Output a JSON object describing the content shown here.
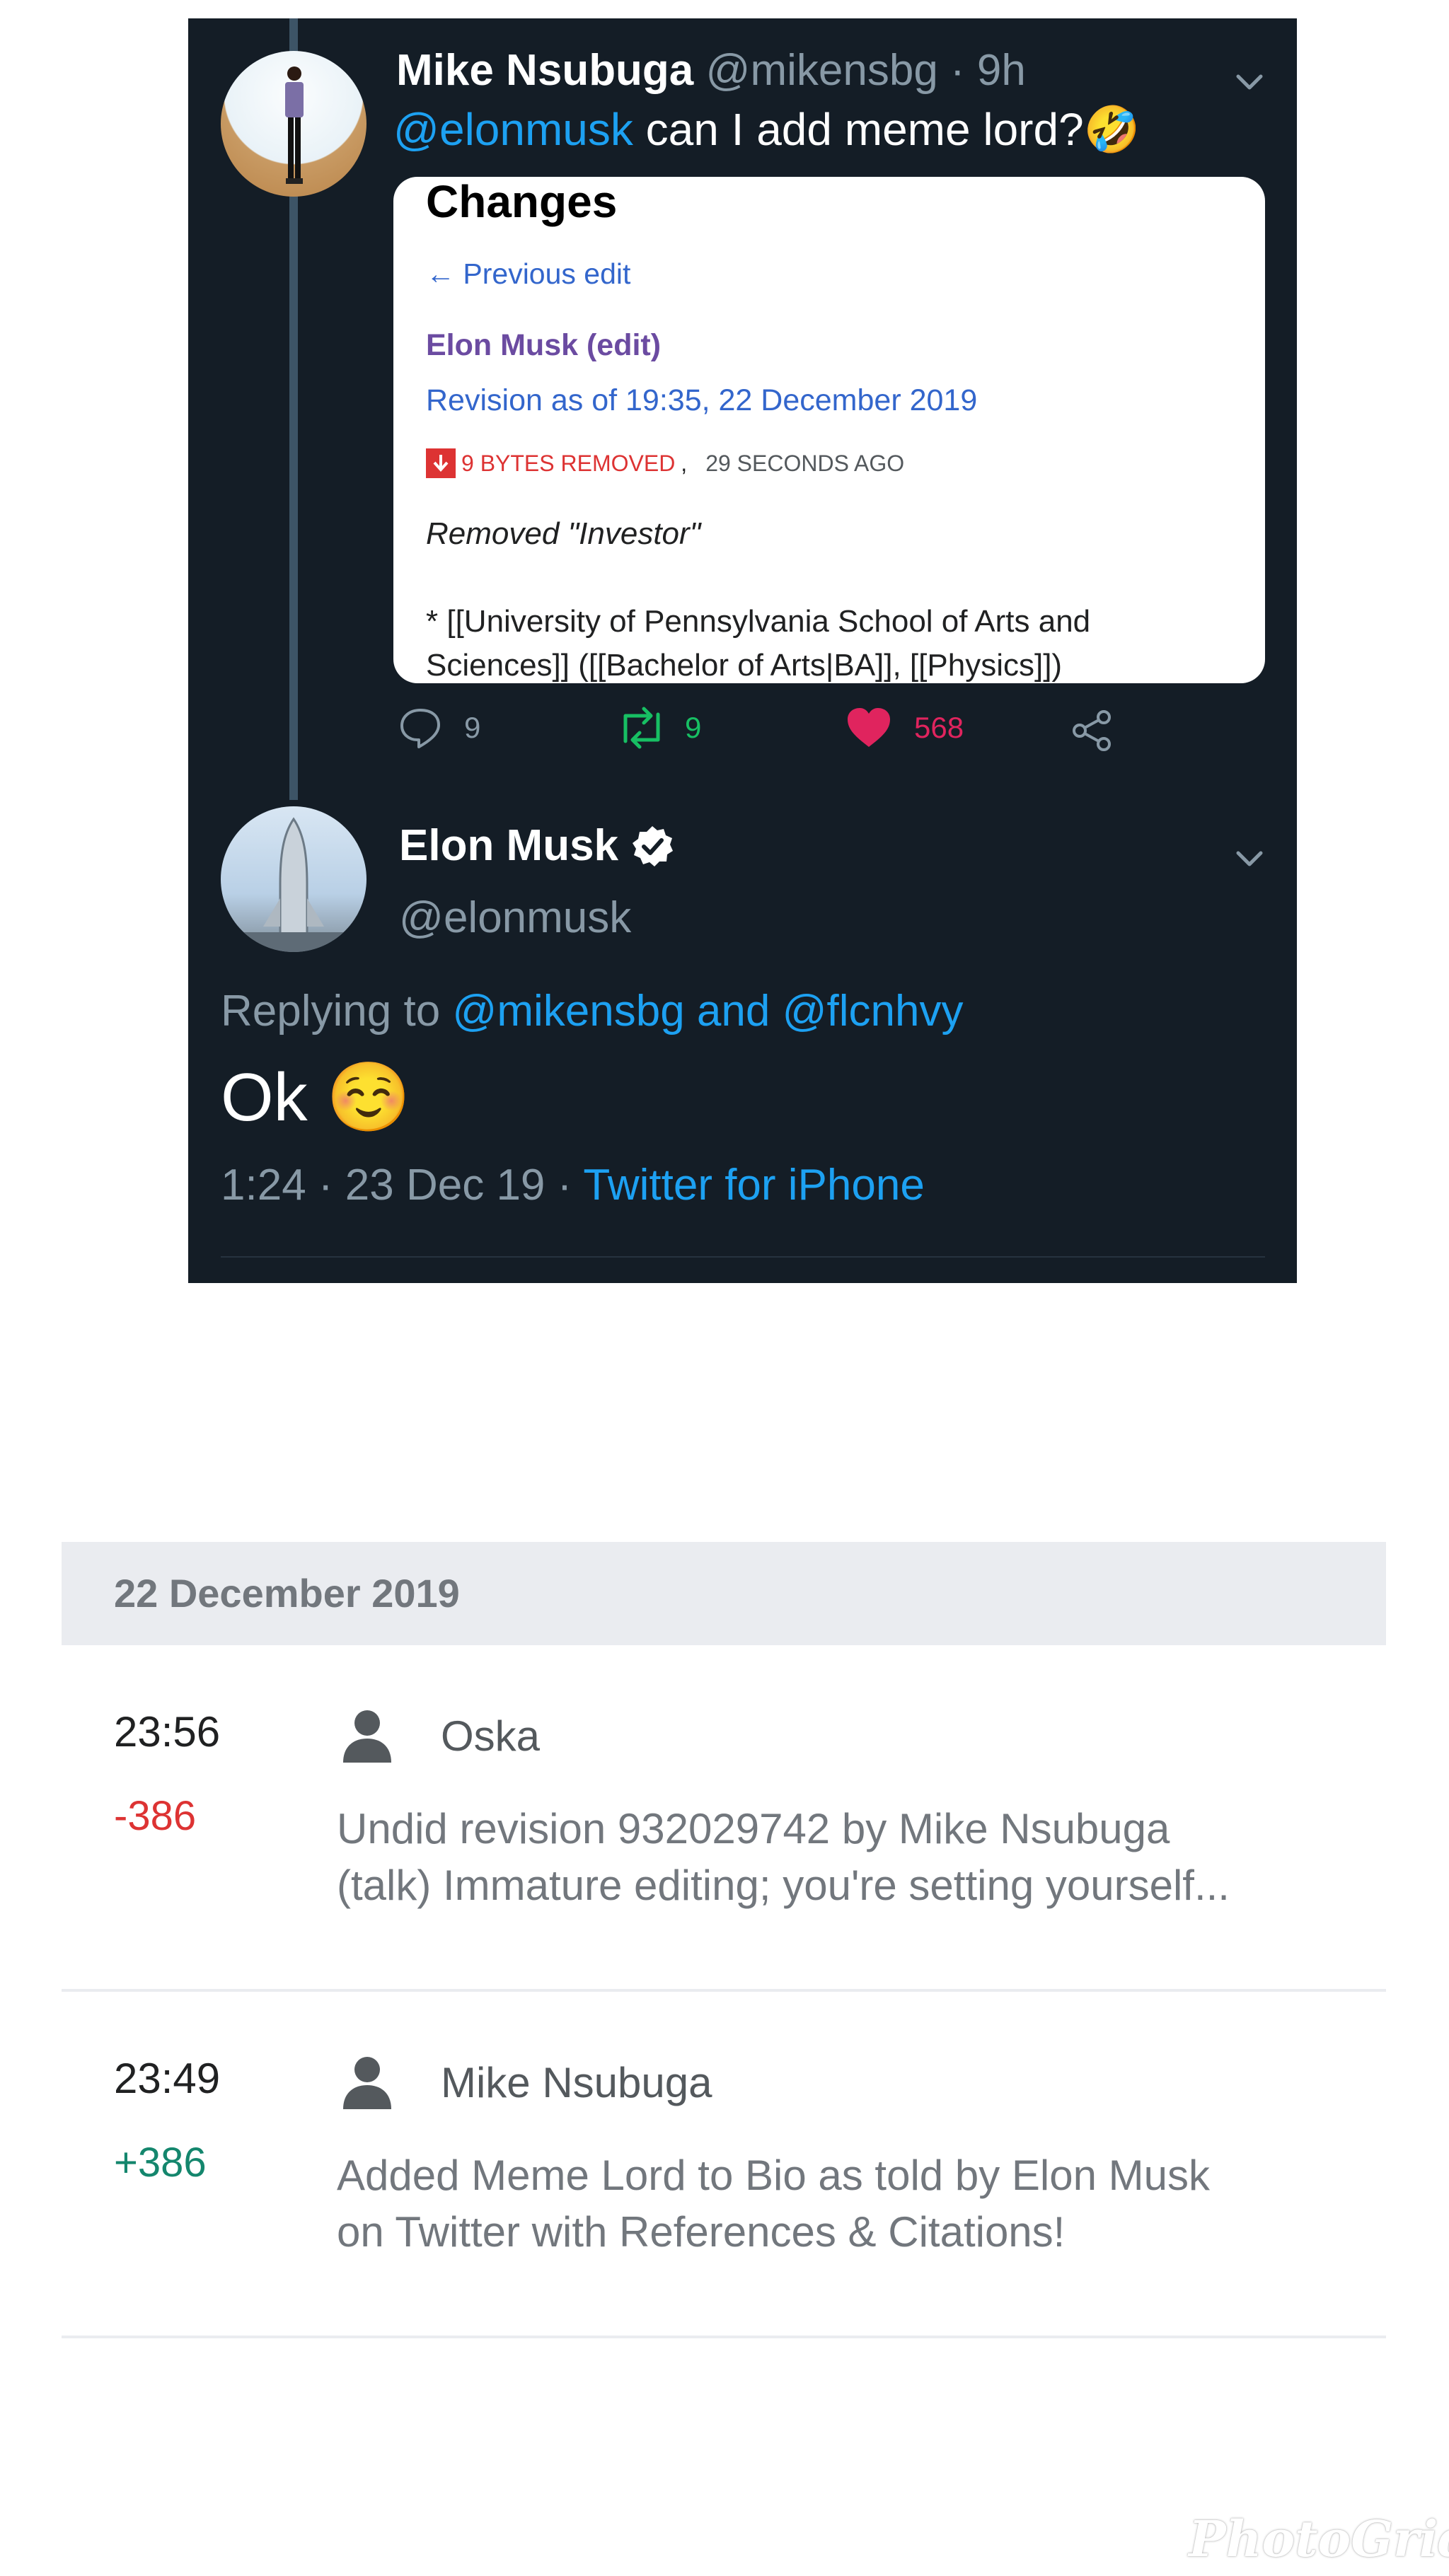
{
  "tweet1": {
    "author_name": "Mike Nsubuga",
    "meta": "@mikensbg · 9h",
    "mention": "@elonmusk",
    "text": " can I add meme lord?🤣",
    "card": {
      "title": "Changes",
      "previous_edit": "← Previous edit",
      "page": "Elon Musk (edit)",
      "revision": "Revision as of 19:35, 22 December 2019",
      "bytes_removed": "9 BYTES REMOVED",
      "bytes_suffix": ",",
      "ago": "29 SECONDS AGO",
      "summary": "Removed \"Investor\"",
      "diff_line1": "* [[University of Pennsylvania School of Arts and",
      "diff_line2": "Sciences]] ([[Bachelor of Arts|BA]], [[Physics]])"
    },
    "actions": {
      "replies": "9",
      "retweets": "9",
      "likes": "568"
    }
  },
  "tweet2": {
    "author_name": "Elon Musk",
    "handle": "@elonmusk",
    "replying_label": "Replying to ",
    "replying_to": "@mikensbg and @flcnhvy",
    "text": "Ok ☺️",
    "timestamp": "1:24 · 23 Dec 19 · ",
    "source": "Twitter for iPhone"
  },
  "history": {
    "date": "22 December 2019",
    "entries": [
      {
        "time": "23:56",
        "delta": "-386",
        "user": "Oska",
        "comment_line1": "Undid revision 932029742 by Mike Nsubuga",
        "comment_line2": "(talk) Immature editing; you're setting yourself..."
      },
      {
        "time": "23:49",
        "delta": "+386",
        "user": "Mike Nsubuga",
        "comment_line1": "Added Meme Lord to Bio as told by Elon Musk",
        "comment_line2": "on Twitter with References & Citations!"
      }
    ]
  },
  "watermark": "PhotoGrid",
  "colors": {
    "twitter_bg": "#141d26",
    "twitter_blue": "#1da1f2",
    "retweet_green": "#17bf63",
    "like_red": "#e0245e",
    "delta_negative": "#d33",
    "delta_positive": "#14866d"
  },
  "icons": [
    "chevron-down-icon",
    "verified-badge-icon",
    "reply-icon",
    "retweet-icon",
    "like-icon",
    "share-icon",
    "user-icon",
    "arrow-down-icon"
  ]
}
